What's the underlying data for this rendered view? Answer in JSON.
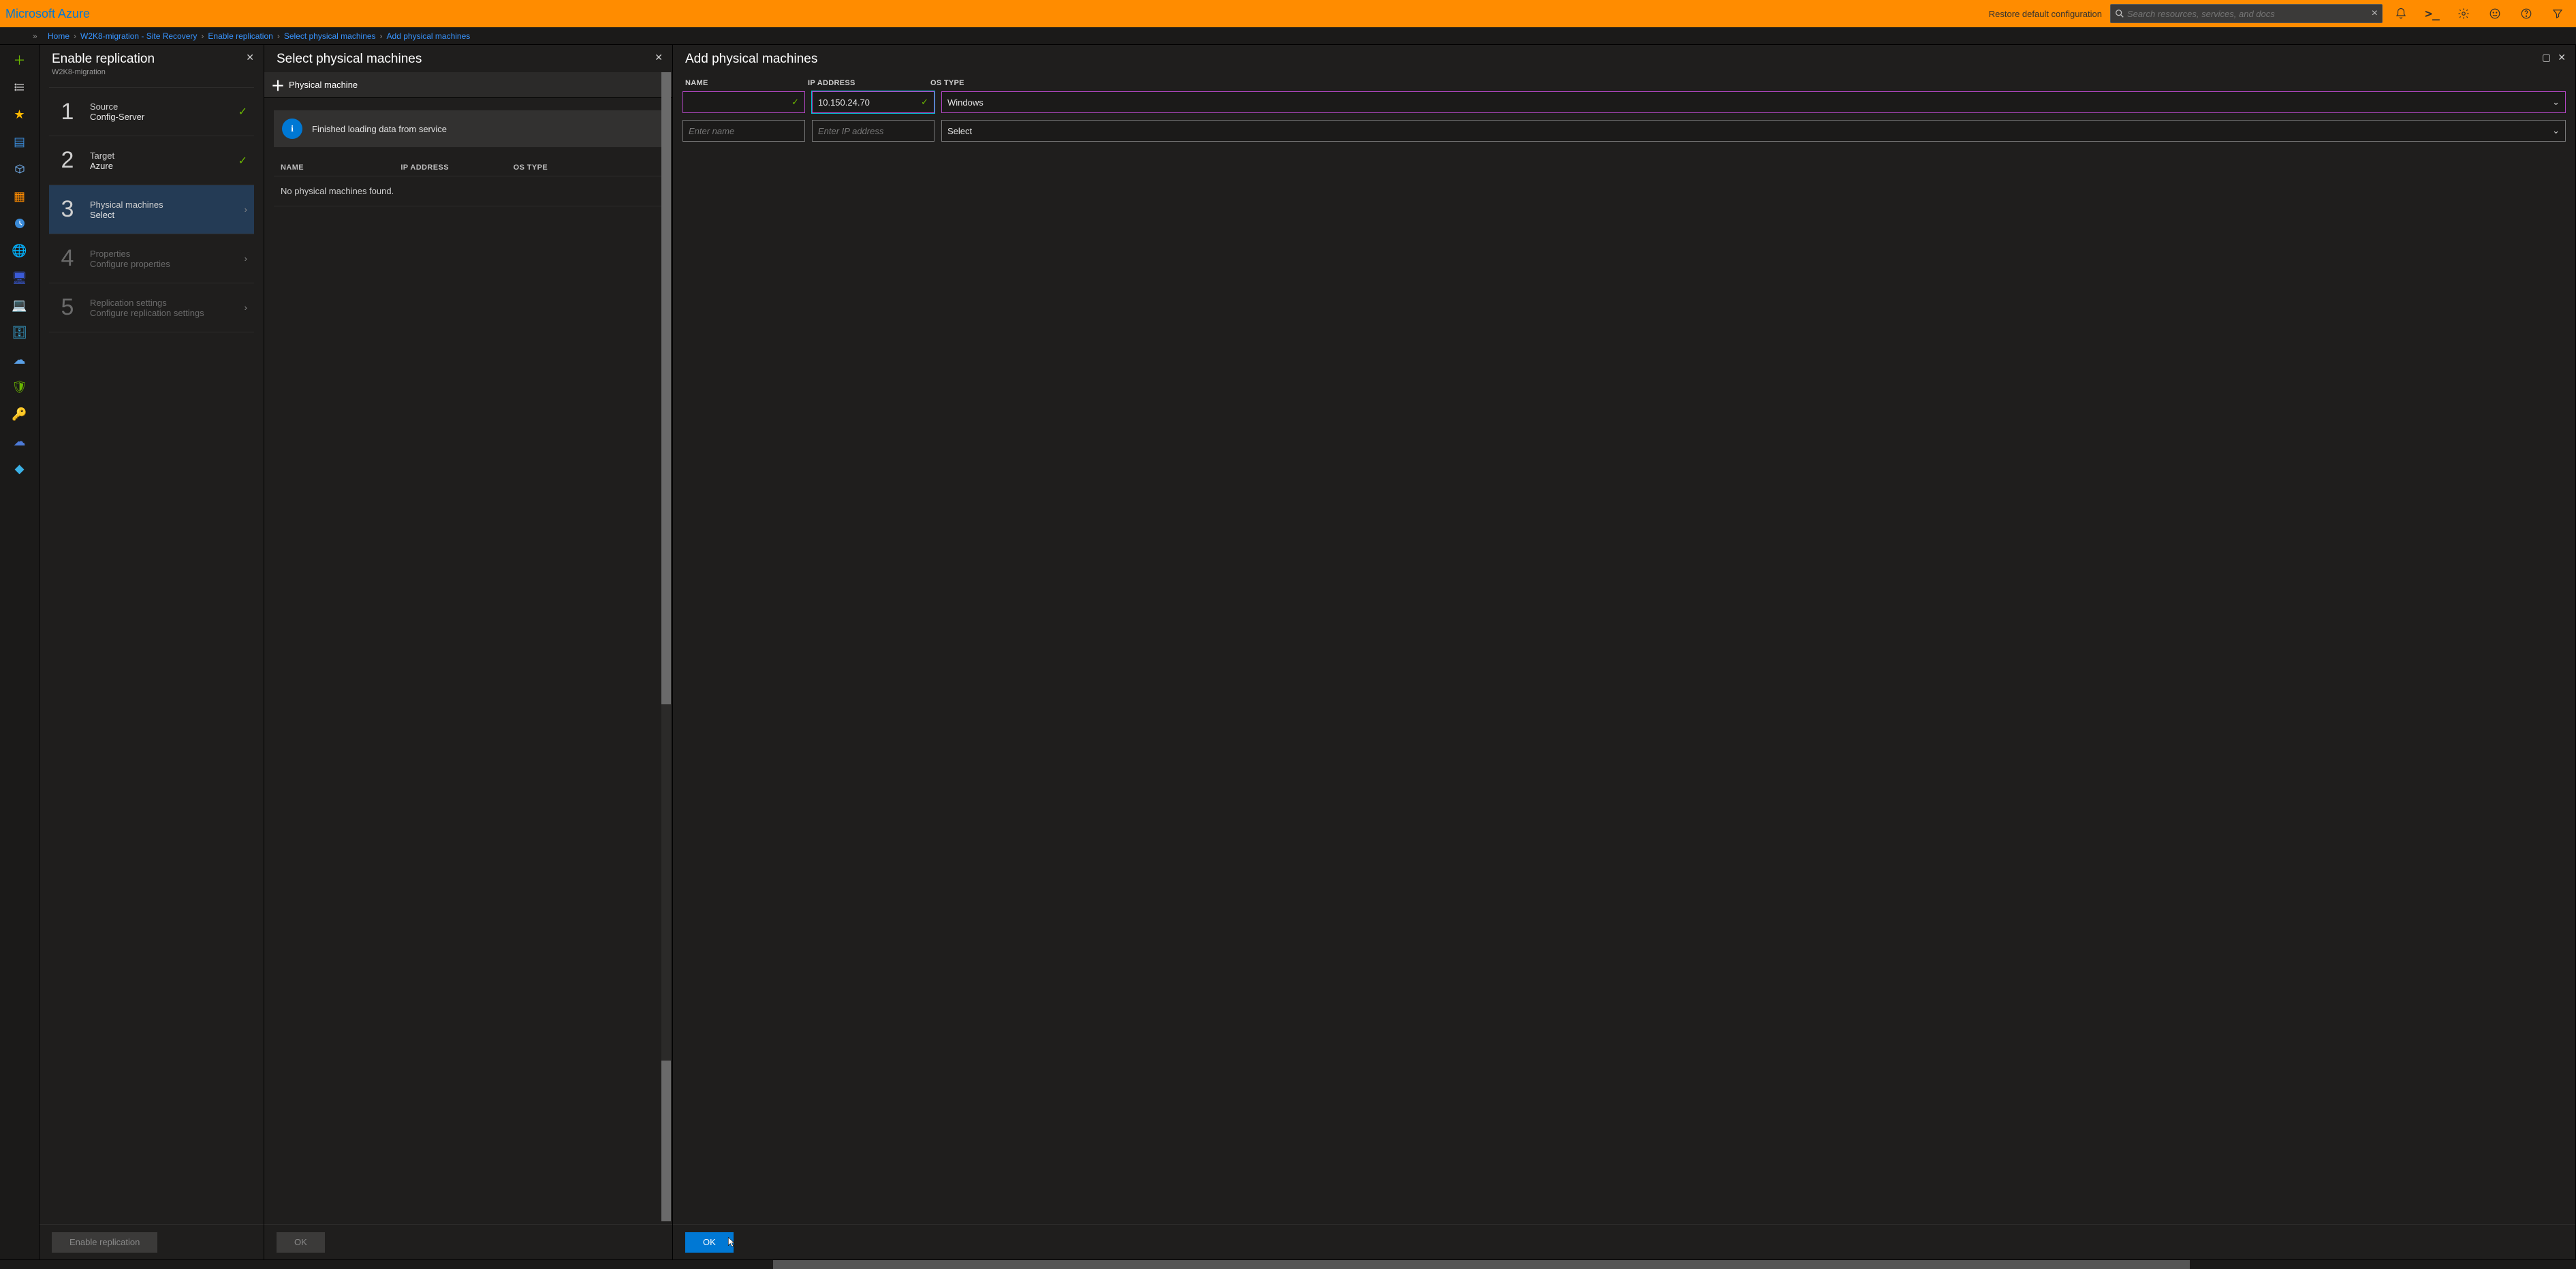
{
  "topbar": {
    "brand": "Microsoft Azure",
    "restore": "Restore default configuration",
    "search_placeholder": "Search resources, services, and docs"
  },
  "breadcrumbs": [
    "Home",
    "W2K8-migration - Site Recovery",
    "Enable replication",
    "Select physical machines",
    "Add physical machines"
  ],
  "blade1": {
    "title": "Enable replication",
    "subtitle": "W2K8-migration",
    "steps": [
      {
        "num": "1",
        "label": "Source",
        "value": "Config-Server",
        "state": "done"
      },
      {
        "num": "2",
        "label": "Target",
        "value": "Azure",
        "state": "done"
      },
      {
        "num": "3",
        "label": "Physical machines",
        "value": "Select",
        "state": "active"
      },
      {
        "num": "4",
        "label": "Properties",
        "value": "Configure properties",
        "state": "dim"
      },
      {
        "num": "5",
        "label": "Replication settings",
        "value": "Configure replication settings",
        "state": "dim"
      }
    ],
    "footer_btn": "Enable replication"
  },
  "blade2": {
    "title": "Select physical machines",
    "cmd_label": "Physical machine",
    "banner": "Finished loading data from service",
    "columns": [
      "NAME",
      "IP ADDRESS",
      "OS TYPE"
    ],
    "empty": "No physical machines found.",
    "footer_btn": "OK"
  },
  "blade3": {
    "title": "Add physical machines",
    "columns": [
      "NAME",
      "IP ADDRESS",
      "OS TYPE"
    ],
    "row1": {
      "name": "",
      "ip": "10.150.24.70",
      "os": "Windows"
    },
    "row2": {
      "name_placeholder": "Enter name",
      "ip_placeholder": "Enter IP address",
      "os": "Select"
    },
    "footer_btn": "OK"
  }
}
